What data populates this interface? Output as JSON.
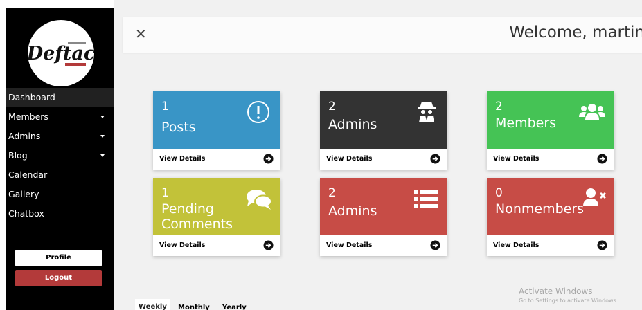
{
  "brand": {
    "logo_text": "Deftac",
    "tagline": "BETTER LIVING"
  },
  "sidebar": {
    "items": [
      {
        "label": "Dashboard",
        "has_caret": false
      },
      {
        "label": "Members",
        "has_caret": true
      },
      {
        "label": "Admins",
        "has_caret": true
      },
      {
        "label": "Blog",
        "has_caret": true
      },
      {
        "label": "Calendar",
        "has_caret": false
      },
      {
        "label": "Gallery",
        "has_caret": false
      },
      {
        "label": "Chatbox",
        "has_caret": false
      }
    ],
    "profile_label": "Profile",
    "logout_label": "Logout"
  },
  "header": {
    "close_icon": "close-icon",
    "welcome": "Welcome, martin"
  },
  "cards": [
    {
      "count": "1",
      "label_line1": "Posts",
      "label_line2": "",
      "color": "#3995c6",
      "icon": "exclamation-circle-icon",
      "link": "View Details"
    },
    {
      "count": "2",
      "label_line1": "Admins",
      "label_line2": "",
      "color": "#333333",
      "icon": "spy-icon",
      "link": "View Details"
    },
    {
      "count": "2",
      "label_line1": "Members",
      "label_line2": "",
      "color": "#45c355",
      "icon": "users-icon",
      "link": "View Details"
    },
    {
      "count": "1",
      "label_line1": "Pending",
      "label_line2": "Comments",
      "color": "#c2c239",
      "icon": "comments-icon",
      "link": "View Details"
    },
    {
      "count": "2",
      "label_line1": "Admins",
      "label_line2": "",
      "color": "#c74c46",
      "icon": "list-icon",
      "link": "View Details"
    },
    {
      "count": "0",
      "label_line1": "Nonmembers",
      "label_line2": "",
      "color": "#c74c46",
      "icon": "user-times-icon",
      "link": "View Details"
    }
  ],
  "tabs": [
    "Weekly",
    "Monthly",
    "Yearly"
  ],
  "watermark": {
    "title": "Activate Windows",
    "subtitle": "Go to Settings to activate Windows."
  }
}
